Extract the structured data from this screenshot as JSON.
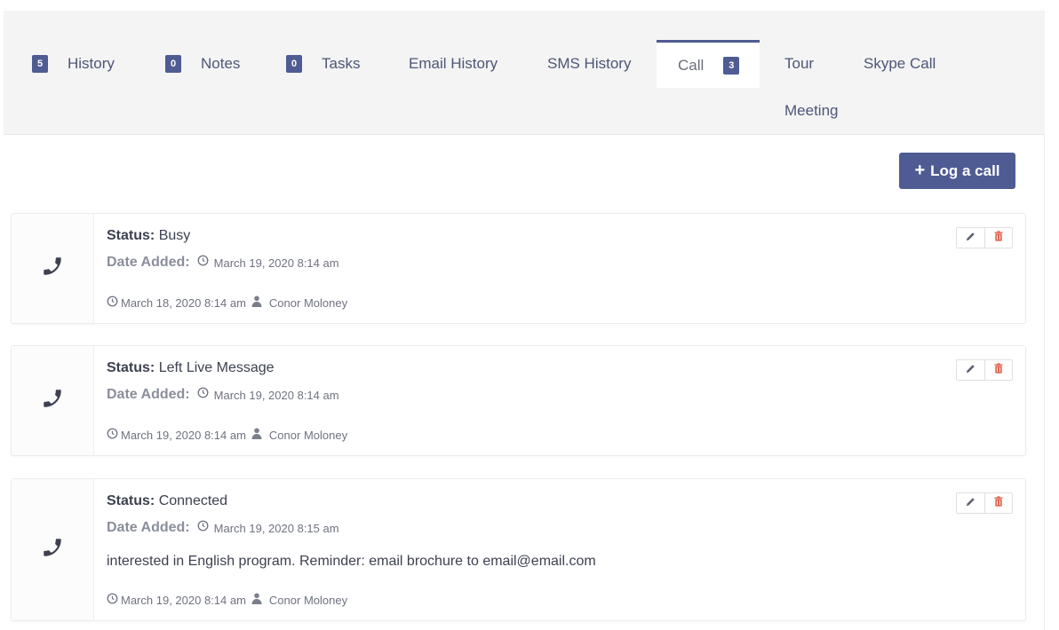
{
  "tabs": [
    {
      "label": "History",
      "badge": "5"
    },
    {
      "label": "Notes",
      "badge": "0"
    },
    {
      "label": "Tasks",
      "badge": "0"
    },
    {
      "label": "Email History"
    },
    {
      "label": "SMS History"
    },
    {
      "label": "Call",
      "badge": "3",
      "active": true
    },
    {
      "label": "Tour"
    },
    {
      "label": "Skype Call"
    },
    {
      "label": "Meeting"
    }
  ],
  "toolbar": {
    "log_call_label": "Log a call",
    "log_call_icon": "plus-icon"
  },
  "labels": {
    "status": "Status:",
    "date_added": "Date Added:"
  },
  "colors": {
    "accent": "#4f5b93",
    "delete": "#e0644f",
    "tab_bg": "#f4f4f5"
  },
  "calls": [
    {
      "status": "Busy",
      "date_added": "March 19, 2020 8:14 am",
      "note": "",
      "timestamp": "March 18, 2020 8:14 am",
      "author": "Conor Moloney"
    },
    {
      "status": "Left Live Message",
      "date_added": "March 19, 2020 8:14 am",
      "note": "",
      "timestamp": "March 19, 2020 8:14 am",
      "author": "Conor Moloney"
    },
    {
      "status": "Connected",
      "date_added": "March 19, 2020 8:15 am",
      "note": "interested in English program. Reminder: email brochure to email@email.com",
      "timestamp": "March 19, 2020 8:14 am",
      "author": "Conor Moloney"
    }
  ]
}
